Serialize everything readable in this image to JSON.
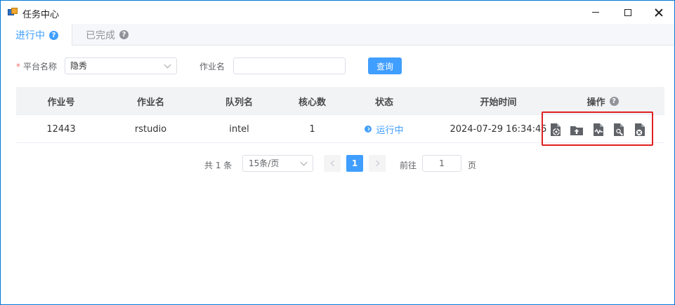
{
  "window": {
    "title": "任务中心",
    "minimize_icon": "minimize-icon",
    "maximize_icon": "maximize-icon",
    "close_icon": "close-icon"
  },
  "tabs": [
    {
      "label": "进行中",
      "active": true,
      "help_icon": "?"
    },
    {
      "label": "已完成",
      "active": false,
      "help_icon": "?"
    }
  ],
  "filters": {
    "platform_label": "平台名称",
    "required_mark": "*",
    "platform_value": "隐秀",
    "job_name_label": "作业名",
    "job_name_value": "",
    "query_button": "查询"
  },
  "table": {
    "headers": {
      "job_id": "作业号",
      "job_name": "作业名",
      "queue": "队列名",
      "cores": "核心数",
      "status": "状态",
      "start_time": "开始时间",
      "actions": "操作",
      "actions_help": "?"
    },
    "rows": [
      {
        "job_id": "12443",
        "job_name": "rstudio",
        "queue": "intel",
        "cores": "1",
        "status": "运行中",
        "start_time": "2024-07-29 16:34:45"
      }
    ],
    "action_icons": [
      "file-settings-icon",
      "folder-upload-icon",
      "file-chart-icon",
      "file-search-icon",
      "file-cancel-icon"
    ]
  },
  "pagination": {
    "total": "共 1 条",
    "page_size": "15条/页",
    "current_page": "1",
    "goto_label": "前往",
    "goto_value": "1",
    "page_suffix": "页"
  },
  "colors": {
    "primary": "#409eff",
    "highlight": "#e02020"
  }
}
